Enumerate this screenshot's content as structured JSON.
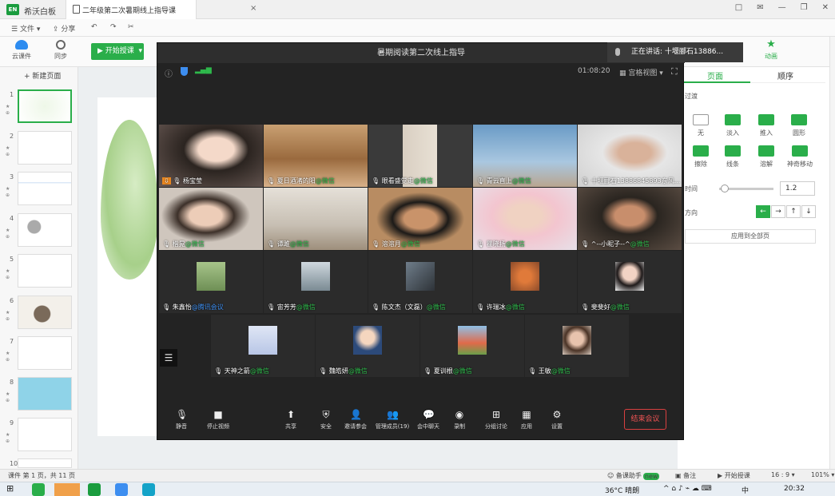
{
  "titlebar": {
    "app_name": "希沃白板",
    "doc_tab": "二年级第二次暑期线上指导课",
    "close": "×",
    "controls": [
      "□",
      "✉",
      "—",
      "❐",
      "✕"
    ]
  },
  "menu": {
    "file": "文件",
    "share": "分享"
  },
  "toolbar": {
    "cloud": "云课件",
    "sync": "同步",
    "start_teaching": "开始授课",
    "animation": "动画"
  },
  "slides_panel": {
    "new_page": "+ 新建页面",
    "pages": [
      "1",
      "2",
      "3",
      "4",
      "5",
      "6",
      "7",
      "8",
      "9",
      "10"
    ]
  },
  "right_panel": {
    "tab_page": "页面",
    "tab_order": "顺序",
    "transition_label": "过渡",
    "transitions": [
      {
        "label": "无"
      },
      {
        "label": "淡入"
      },
      {
        "label": "推入"
      },
      {
        "label": "圆形"
      },
      {
        "label": "擦除"
      },
      {
        "label": "线条"
      },
      {
        "label": "溶解"
      },
      {
        "label": "神奇移动"
      }
    ],
    "time_label": "时间",
    "time_value": "1.2",
    "direction_label": "方向",
    "directions": [
      "←",
      "→",
      "↑",
      "↓"
    ],
    "apply_all": "应用到全部页"
  },
  "meeting": {
    "title": "暑期阅读第二次线上指导",
    "speaking": "正在讲话: 十堰郦石13886...",
    "timer": "01:08:20",
    "grid_view": "宫格视图",
    "participants": [
      {
        "name": "杨宝莹",
        "tag": ""
      },
      {
        "name": "夏日酒渚的阳",
        "tag": "@微信"
      },
      {
        "name": "眼看盛觉走",
        "tag": "@微信"
      },
      {
        "name": "青云直上",
        "tag": "@微信"
      },
      {
        "name": "十堰郦石13886845893东风...",
        "tag": ""
      },
      {
        "name": "楷晃",
        "tag": "@微信"
      },
      {
        "name": "谭雎",
        "tag": "@微信"
      },
      {
        "name": "溶溶月",
        "tag": "@微信"
      },
      {
        "name": "瞿晓扬",
        "tag": "@微信"
      },
      {
        "name": "^--小昵子--^",
        "tag": "@微信"
      },
      {
        "name": "朱鑫怡",
        "tag": "@腾讯会议"
      },
      {
        "name": "宙芳芳",
        "tag": "@微信"
      },
      {
        "name": "陈文杰（文磊）",
        "tag": "@微信"
      },
      {
        "name": "许瑞冰",
        "tag": "@微信"
      },
      {
        "name": "斐斐好",
        "tag": "@微信"
      },
      {
        "name": "天神之箭",
        "tag": "@微信"
      },
      {
        "name": "魏皓妍",
        "tag": "@微信"
      },
      {
        "name": "夏训根",
        "tag": "@微信"
      },
      {
        "name": "王敏",
        "tag": "@微信"
      }
    ],
    "controls": [
      {
        "label": "静音",
        "icon": "mic-icon"
      },
      {
        "label": "停止视频",
        "icon": "camera-icon"
      },
      {
        "label": "共享",
        "icon": "share-screen-icon"
      },
      {
        "label": "安全",
        "icon": "shield-icon"
      },
      {
        "label": "邀请参会",
        "icon": "invite-icon"
      },
      {
        "label": "管理成员(19)",
        "icon": "members-icon"
      },
      {
        "label": "会中聊天",
        "icon": "chat-icon"
      },
      {
        "label": "录制",
        "icon": "record-icon"
      },
      {
        "label": "分组讨论",
        "icon": "breakout-icon"
      },
      {
        "label": "应用",
        "icon": "apps-icon"
      },
      {
        "label": "设置",
        "icon": "gear-icon"
      }
    ],
    "end": "结束会议"
  },
  "status": {
    "page_info": "课件 第 1 页，共 11 页",
    "assistant": "备课助手",
    "new_badge": "new",
    "notes": "备注",
    "start": "开始授课",
    "ratio": "16 : 9",
    "zoom": "101%"
  },
  "taskbar": {
    "weather": "36°C 晴朗",
    "ime": "中",
    "time": "20:32"
  },
  "colors": {
    "accent": "#2aae4a",
    "meeting_bg": "#232323",
    "wechat_tag": "#2eb84b",
    "end_red": "#f05454"
  }
}
